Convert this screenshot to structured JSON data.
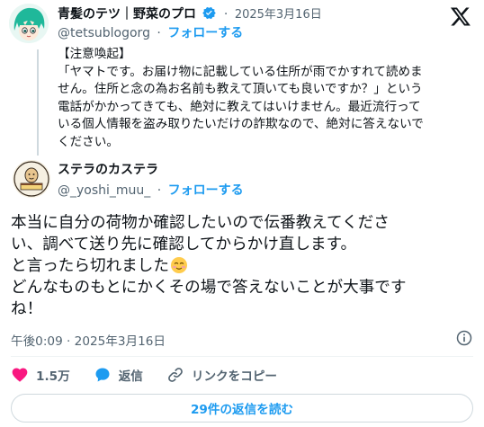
{
  "parent_tweet": {
    "display_name": "青髪のテツ｜野菜のプロ",
    "handle": "@tetsublogorg",
    "separator": "·",
    "date": "2025年3月16日",
    "follow_label": "フォローする",
    "text_lines": [
      "【注意喚起】",
      "「ヤマトです。お届け物に記載している住所が雨でかすれて読めま",
      "せん。住所と念の為お名前も教えて頂いても良いですか？」という",
      "電話がかかってきても、絶対に教えてはいけません。最近流行って",
      "いる個人情報を盗み取りたいだけの詐欺なので、絶対に答えないで",
      "ください。"
    ]
  },
  "reply_tweet": {
    "display_name": "ステラのカステラ",
    "handle": "@_yoshi_muu_",
    "separator": "·",
    "follow_label": "フォローする",
    "text_lines": [
      "本当に自分の荷物か確認したいので伝番教えてくださ",
      "い、調べて送り先に確認してからかけ直します。",
      "と言ったら切れました",
      "どんなものもとにかくその場で答えないことが大事です",
      "ね！"
    ],
    "timestamp": "午後0:09 · 2025年3月16日"
  },
  "actions": {
    "likes": "1.5万",
    "reply_label": "返信",
    "copy_link_label": "リンクをコピー"
  },
  "read_replies_label": "29件の返信を読む",
  "colors": {
    "accent": "#1d9bf0",
    "like": "#f91880",
    "text": "#0f1419",
    "muted": "#536471"
  },
  "icons": [
    "x-logo-icon",
    "verified-badge-icon",
    "heart-icon",
    "reply-bubble-icon",
    "link-icon",
    "info-icon",
    "smiling-face-emoji"
  ]
}
